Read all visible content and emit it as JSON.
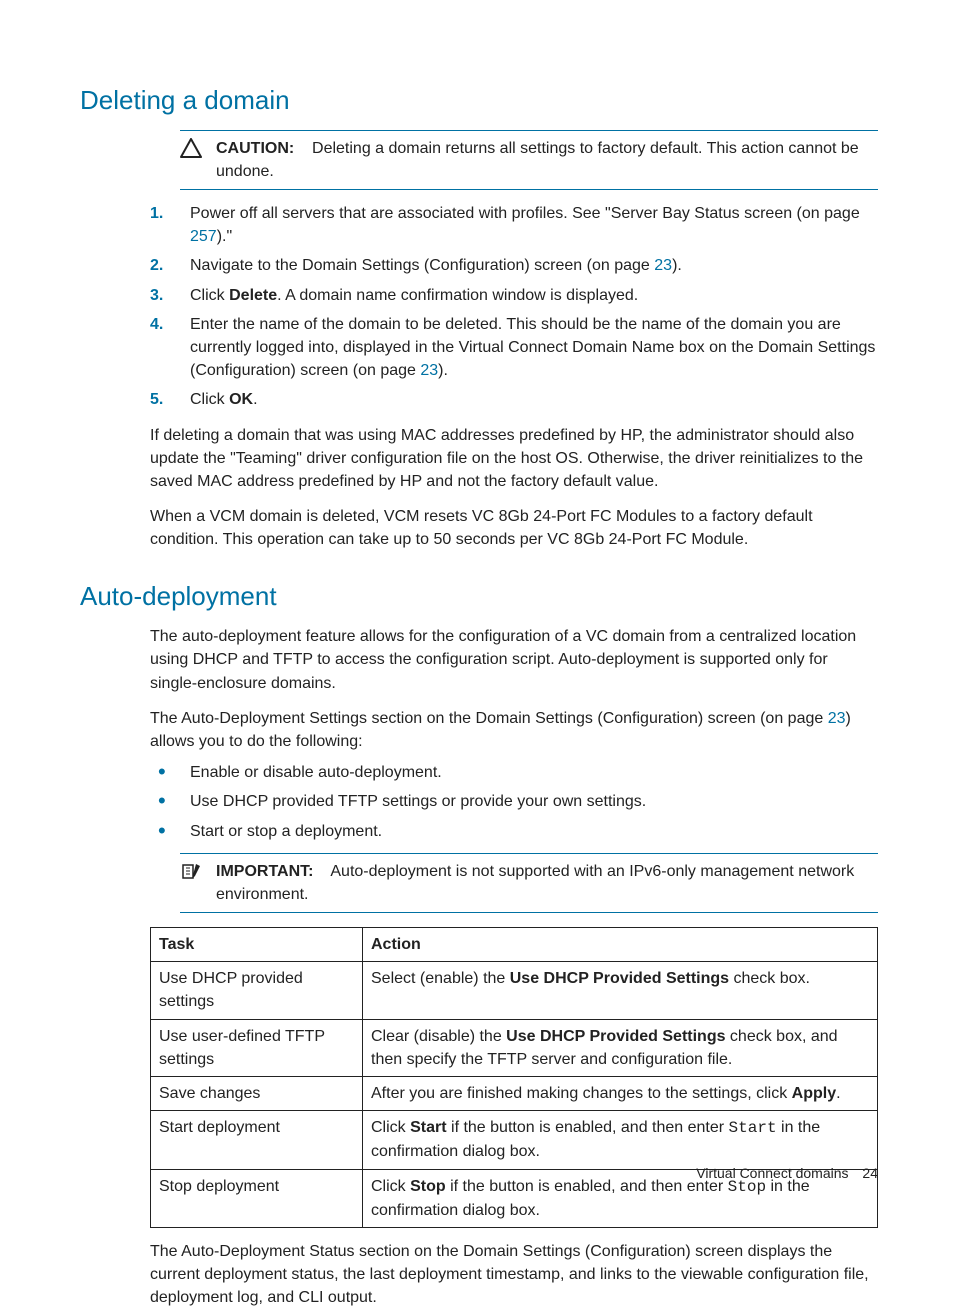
{
  "section1": {
    "title": "Deleting a domain",
    "caution": {
      "label": "CAUTION:",
      "text": "Deleting a domain returns all settings to factory default. This action cannot be undone."
    },
    "steps": {
      "s1_a": "Power off all servers that are associated with profiles. See \"Server Bay Status screen (on page ",
      "s1_link": "257",
      "s1_b": ").\"",
      "s2_a": "Navigate to the Domain Settings (Configuration) screen (on page ",
      "s2_link": "23",
      "s2_b": ").",
      "s3_a": "Click ",
      "s3_bold": "Delete",
      "s3_b": ". A domain name confirmation window is displayed.",
      "s4_a": "Enter the name of the domain to be deleted. This should be the name of the domain you are currently logged into, displayed in the Virtual Connect Domain Name box on the Domain Settings (Configuration) screen (on page ",
      "s4_link": "23",
      "s4_b": ").",
      "s5_a": "Click ",
      "s5_bold": "OK",
      "s5_b": "."
    },
    "para1": "If deleting a domain that was using MAC addresses predefined by HP, the administrator should also update the \"Teaming\" driver configuration file on the host OS. Otherwise, the driver reinitializes to the saved MAC address predefined by HP and not the factory default value.",
    "para2": "When a VCM domain is deleted, VCM resets VC 8Gb 24-Port FC Modules to a factory default condition. This operation can take up to 50 seconds per VC 8Gb 24-Port FC Module."
  },
  "section2": {
    "title": "Auto-deployment",
    "para1": "The auto-deployment feature allows for the configuration of a VC domain from a centralized location using DHCP and TFTP to access the configuration script. Auto-deployment is supported only for single-enclosure domains.",
    "para2_a": "The Auto-Deployment Settings section on the Domain Settings (Configuration) screen (on page ",
    "para2_link": "23",
    "para2_b": ") allows you to do the following:",
    "bullets": {
      "b1": "Enable or disable auto-deployment.",
      "b2": "Use DHCP provided TFTP settings or provide your own settings.",
      "b3": "Start or stop a deployment."
    },
    "important": {
      "label": "IMPORTANT:",
      "text": "Auto-deployment is not supported with an IPv6-only management network environment."
    },
    "table": {
      "header": {
        "task": "Task",
        "action": "Action"
      },
      "rows": {
        "r1": {
          "task": "Use DHCP provided settings",
          "a1": "Select (enable) the ",
          "a1_bold": "Use DHCP Provided Settings",
          "a1b": " check box."
        },
        "r2": {
          "task": "Use user-defined TFTP settings",
          "a1": "Clear (disable) the ",
          "a1_bold": "Use DHCP Provided Settings",
          "a1b": " check box, and then specify the TFTP server and configuration file."
        },
        "r3": {
          "task": "Save changes",
          "a1": "After you are finished making changes to the settings, click ",
          "a1_bold": "Apply",
          "a1b": "."
        },
        "r4": {
          "task": "Start deployment",
          "a1": "Click ",
          "a1_bold": "Start",
          "a1b": " if the button is enabled, and then enter ",
          "a1_mono": "Start",
          "a1c": " in the confirmation dialog box."
        },
        "r5": {
          "task": "Stop deployment",
          "a1": "Click ",
          "a1_bold": "Stop",
          "a1b": " if the button is enabled, and then enter ",
          "a1_mono": "Stop",
          "a1c": " in the confirmation dialog box."
        }
      }
    },
    "para3": "The Auto-Deployment Status section on the Domain Settings (Configuration) screen displays the current deployment status, the last deployment timestamp, and links to the viewable configuration file, deployment log, and CLI output."
  },
  "footer": {
    "text": "Virtual Connect domains",
    "page": "24"
  }
}
